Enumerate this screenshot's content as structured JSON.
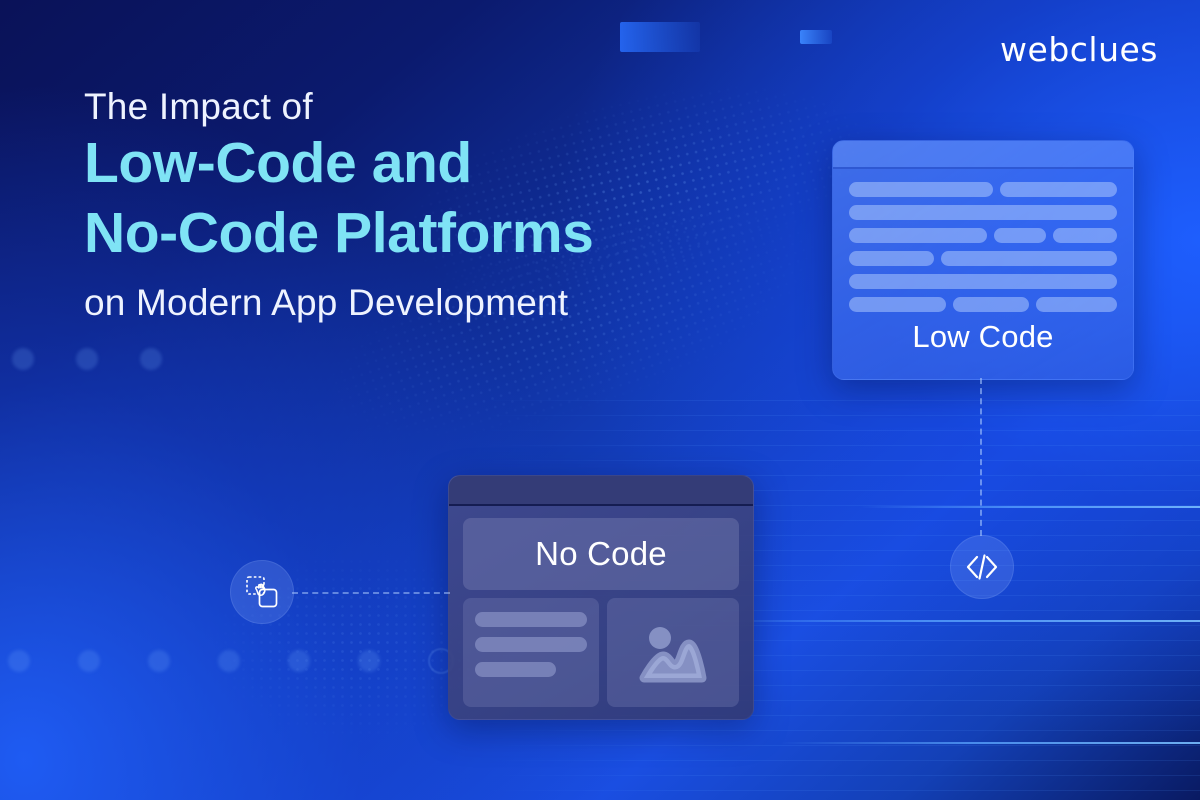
{
  "brand": {
    "logo_text": "webclues"
  },
  "headline": {
    "line1": "The Impact of",
    "line2": "Low-Code and",
    "line3": "No-Code Platforms",
    "line4": "on Modern App Development"
  },
  "colors": {
    "accent_cyan": "#7fe3f5",
    "text_white": "#eef3ff",
    "bg_deep_navy": "#0a1258",
    "bg_bright_blue": "#1a4ee2",
    "low_code_card": "#5c8cff",
    "no_code_card": "#424a8c"
  },
  "cards": {
    "low_code": {
      "caption": "Low Code",
      "icon_name": "window-card",
      "code_rows": [
        [
          52,
          42
        ],
        [
          100
        ],
        [
          52,
          20,
          24
        ],
        [
          30,
          62
        ],
        [
          100
        ],
        [
          36,
          28,
          30
        ]
      ]
    },
    "no_code": {
      "caption": "No Code",
      "icon_name": "window-card",
      "left_panel_bars": [
        100,
        100,
        72
      ],
      "right_panel_icon": "image-placeholder-icon"
    }
  },
  "badges": [
    {
      "name": "code-badge",
      "icon_name": "code-brackets-icon",
      "glyph": "</>"
    },
    {
      "name": "drag-badge",
      "icon_name": "drag-and-drop-icon",
      "glyph": ""
    }
  ],
  "decorations": {
    "dot_row_count": 6,
    "scanlines": true,
    "dot_mesh": true
  }
}
